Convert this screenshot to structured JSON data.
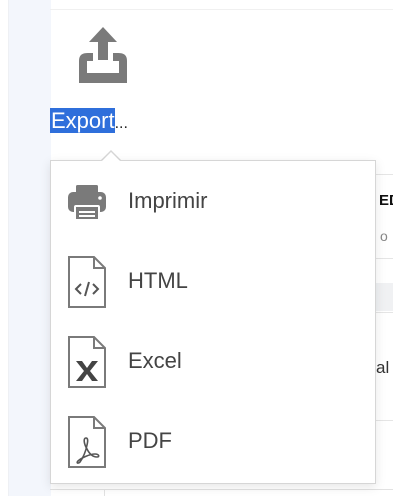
{
  "export": {
    "label_highlighted": "Export",
    "label_suffix": "...",
    "icon": "upload-tray-icon"
  },
  "menu": {
    "items": [
      {
        "label": "Imprimir",
        "icon": "printer-icon"
      },
      {
        "label": "HTML",
        "icon": "html-file-icon"
      },
      {
        "label": "Excel",
        "icon": "excel-file-icon"
      },
      {
        "label": "PDF",
        "icon": "pdf-file-icon"
      }
    ]
  },
  "background": {
    "header_fragment": "ED",
    "sub_fragment": "o",
    "row_fragment": "al"
  },
  "colors": {
    "highlight": "#2f6fdb",
    "icon_gray": "#777777",
    "panel": "#f3f6fc"
  }
}
